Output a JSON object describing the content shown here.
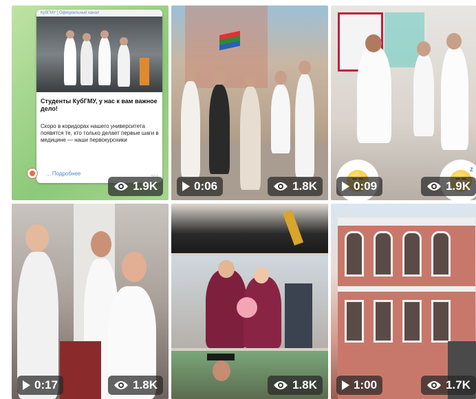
{
  "grid": [
    {
      "type": "post",
      "post": {
        "channel": "КубГМУ | Официальный канал",
        "title": "Студенты КубГМУ, у нас к вам важное дело!",
        "body": "Скоро в коридорах нашего университета появятся те, кто только делает первые шаги в медицине — наши первокурсники",
        "more": "... Подробнее",
        "time": "5/12"
      },
      "views": "1.9K"
    },
    {
      "type": "video",
      "duration": "0:06",
      "views": "1.8K"
    },
    {
      "type": "video",
      "duration": "0:09",
      "views": "1.9K",
      "reaction_emoji": "dizzy-face-emoji",
      "reaction_emoji_2": "sleeping-face-emoji"
    },
    {
      "type": "video",
      "duration": "0:17",
      "views": "1.8K"
    },
    {
      "type": "photo",
      "views": "1.8K"
    },
    {
      "type": "video",
      "duration": "1:00",
      "views": "1.7K"
    }
  ],
  "colors": {
    "overlay": "#282828",
    "link": "#4a86c8",
    "bg": "#ffffff"
  },
  "icons": {
    "views": "eye-icon",
    "play": "play-icon"
  }
}
